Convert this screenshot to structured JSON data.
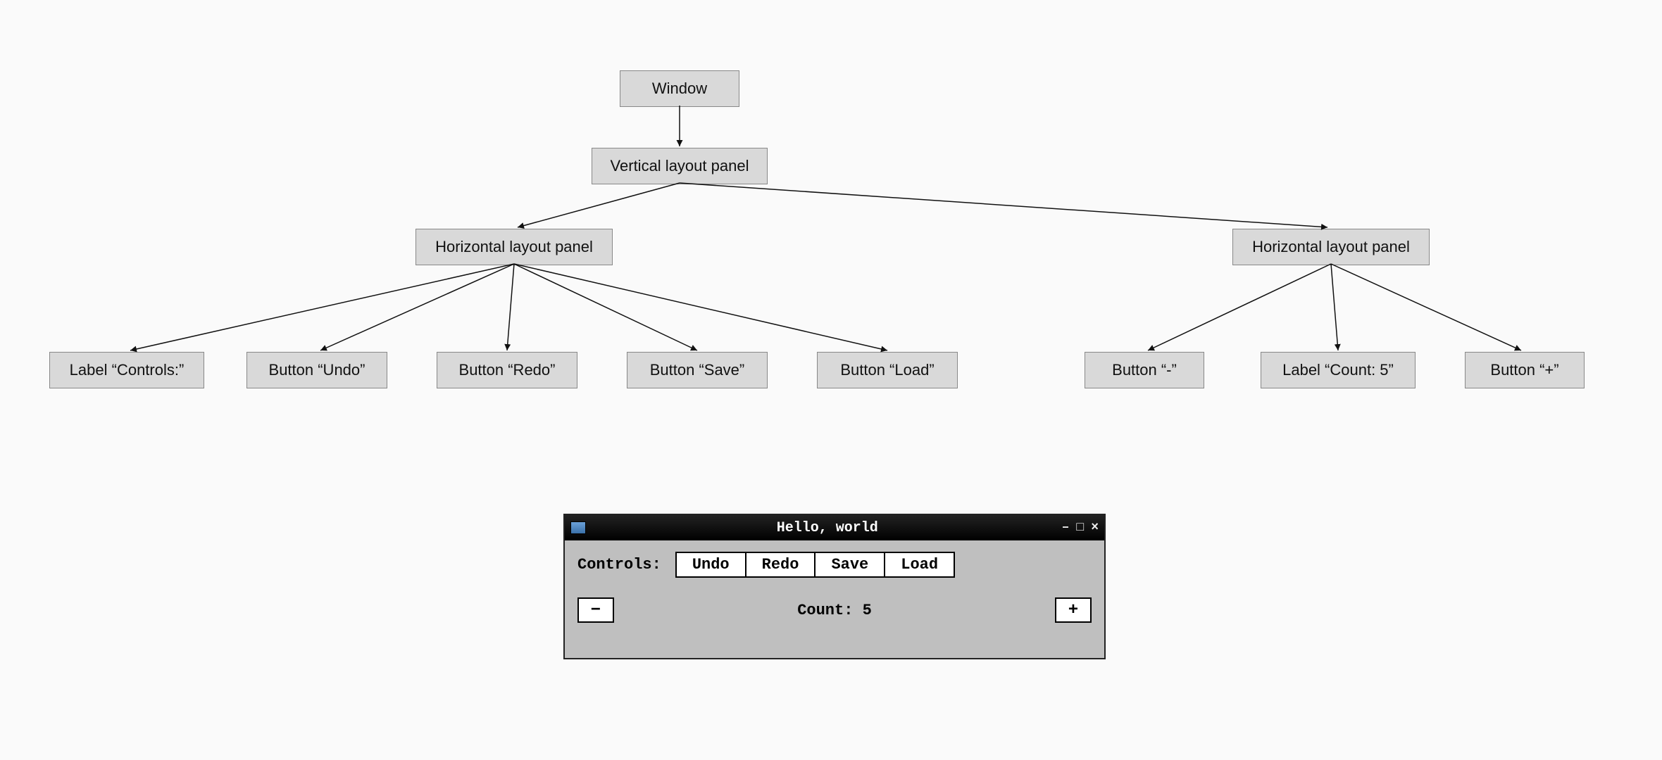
{
  "tree": {
    "root": "Window",
    "vpanel": "Vertical layout panel",
    "hpanel1": "Horizontal layout panel",
    "hpanel2": "Horizontal layout panel",
    "leaves1": {
      "controls_label": "Label “Controls:”",
      "undo": "Button “Undo”",
      "redo": "Button “Redo”",
      "save": "Button “Save”",
      "load": "Button “Load”"
    },
    "leaves2": {
      "minus": "Button “-”",
      "count_label": "Label “Count: 5”",
      "plus": "Button “+”"
    }
  },
  "window": {
    "title": "Hello, world",
    "controls_label": "Controls:",
    "buttons": {
      "undo": "Undo",
      "redo": "Redo",
      "save": "Save",
      "load": "Load"
    },
    "minus": "−",
    "plus": "+",
    "count_text": "Count: 5",
    "win_controls": {
      "min": "–",
      "max": "□",
      "close": "×"
    }
  }
}
